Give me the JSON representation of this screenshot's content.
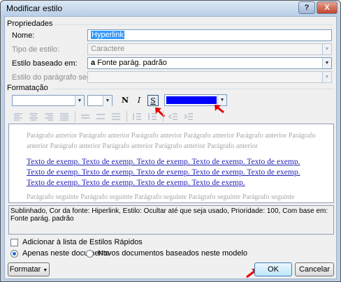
{
  "window": {
    "title": "Modificar estilo",
    "help_label": "?",
    "close_label": "X"
  },
  "propriedades": {
    "group_label": "Propriedades",
    "nome_label": "Nome:",
    "nome_value": "Hyperlink",
    "tipo_label": "Tipo de estilo:",
    "tipo_value": "Caractere",
    "baseado_label": "Estilo baseado em:",
    "baseado_value": "Fonte parág. padrão",
    "baseado_icon": "a",
    "seguinte_label": "Estilo do parágrafo seguinte:",
    "seguinte_value": ""
  },
  "formatacao": {
    "group_label": "Formatação",
    "bold": "N",
    "italic": "I",
    "underline": "S",
    "font_color": "#0000ff"
  },
  "preview": {
    "previous_text": "Parágrafo anterior Parágrafo anterior Parágrafo anterior Parágrafo anterior Parágrafo anterior Parágrafo anterior Parágrafo anterior Parágrafo anterior Parágrafo anterior Parágrafo anterior",
    "sample_text": "Texto de exemp. Texto de exemp. Texto de exemp. Texto de exemp. Texto de exemp. Texto de exemp. Texto de exemp. Texto de exemp. Texto de exemp. Texto de exemp. Texto de exemp. Texto de exemp. Texto de exemp. Texto de exemp.",
    "next_text": "Parágrafo seguinte Parágrafo seguinte Parágrafo seguinte Parágrafo seguinte Parágrafo seguinte"
  },
  "description": "Sublinhado, Cor da fonte: Hiperlink, Estilo: Ocultar até que seja usado, Prioridade: 100, Com base em: Fonte parág. padrão",
  "options": {
    "add_quick_styles": "Adicionar à lista de Estilos Rápidos",
    "only_document": "Apenas neste documento",
    "new_documents": "Novos documentos baseados neste modelo"
  },
  "buttons": {
    "formatar": "Formatar",
    "ok": "OK",
    "cancelar": "Cancelar"
  }
}
